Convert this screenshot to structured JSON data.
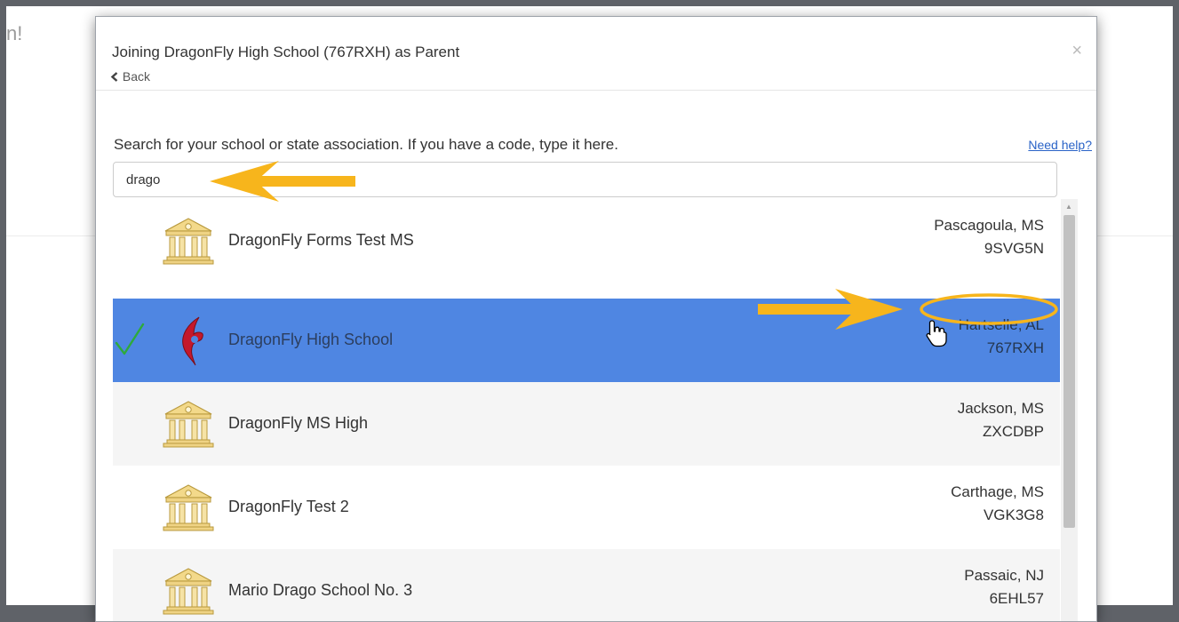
{
  "backdrop": {
    "partial_text": "n!"
  },
  "modal": {
    "title": "Joining DragonFly High School (767RXH) as Parent",
    "back_label": "Back",
    "close_label": "×"
  },
  "search": {
    "instructions": "Search for your school or state association. If you have a code, type it here.",
    "help_label": "Need help?",
    "value": "drago"
  },
  "results": [
    {
      "name": "DragonFly Forms Test MS",
      "location": "Pascagoula, MS",
      "code": "9SVG5N",
      "icon": "school-building-icon",
      "selected": false
    },
    {
      "name": "DragonFly High School",
      "location": "Hartselle, AL",
      "code": "767RXH",
      "icon": "dragonfly-logo-icon",
      "selected": true
    },
    {
      "name": "DragonFly MS High",
      "location": "Jackson, MS",
      "code": "ZXCDBP",
      "icon": "school-building-icon",
      "selected": false
    },
    {
      "name": "DragonFly Test 2",
      "location": "Carthage, MS",
      "code": "VGK3G8",
      "icon": "school-building-icon",
      "selected": false
    },
    {
      "name": "Mario Drago School No. 3",
      "location": "Passaic, NJ",
      "code": "6EHL57",
      "icon": "school-building-icon",
      "selected": false
    }
  ],
  "colors": {
    "selected_row": "#4f86e2",
    "alt_row": "#f5f5f5",
    "annotation": "#f7b51c",
    "check": "#2eaa3c",
    "link": "#2a63c7"
  }
}
